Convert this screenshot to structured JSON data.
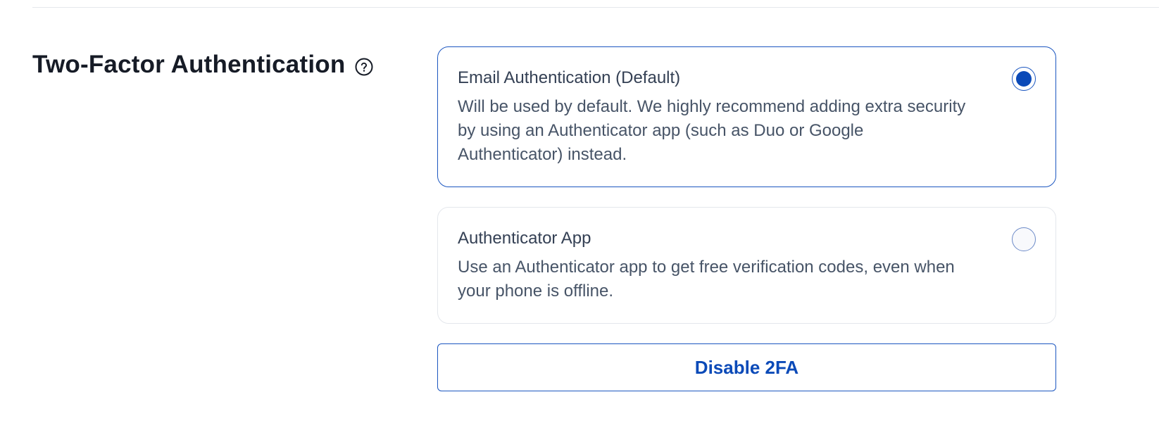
{
  "section": {
    "title": "Two-Factor Authentication",
    "help_icon": "question-circle-icon"
  },
  "options": [
    {
      "title": "Email Authentication (Default)",
      "description": "Will be used by default. We highly recommend adding extra security by using an Authenticator app (such as Duo or Google Authenticator) instead.",
      "selected": true
    },
    {
      "title": "Authenticator App",
      "description": "Use an Authenticator app to get free verification codes, even when your phone is offline.",
      "selected": false
    }
  ],
  "actions": {
    "disable_label": "Disable 2FA"
  },
  "colors": {
    "accent": "#0b4ab8",
    "accent_border": "#1b56c0",
    "border": "#e4e7ec",
    "heading": "#161b26",
    "body_text": "#475467"
  }
}
